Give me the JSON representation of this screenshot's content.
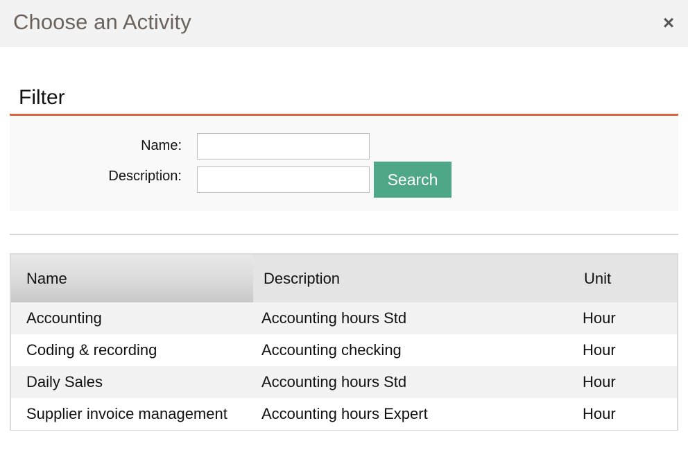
{
  "dialog": {
    "title": "Choose an Activity",
    "close_glyph": "×"
  },
  "filter": {
    "heading": "Filter",
    "name_label": "Name:",
    "name_value": "",
    "description_label": "Description:",
    "description_value": "",
    "search_label": "Search"
  },
  "table": {
    "columns": [
      "Name",
      "Description",
      "Unit"
    ],
    "rows": [
      {
        "name": "Accounting",
        "description": "Accounting hours Std",
        "unit": "Hour"
      },
      {
        "name": "Coding & recording",
        "description": "Accounting checking",
        "unit": "Hour"
      },
      {
        "name": "Daily Sales",
        "description": "Accounting hours Std",
        "unit": "Hour"
      },
      {
        "name": "Supplier invoice management",
        "description": "Accounting hours Expert",
        "unit": "Hour"
      }
    ]
  },
  "colors": {
    "title_bar": "#f2f2f2",
    "accent_rule": "#d9653d",
    "search_button": "#4ea888",
    "header_row": "#e4e4e4",
    "odd_row": "#f2f2f2"
  }
}
